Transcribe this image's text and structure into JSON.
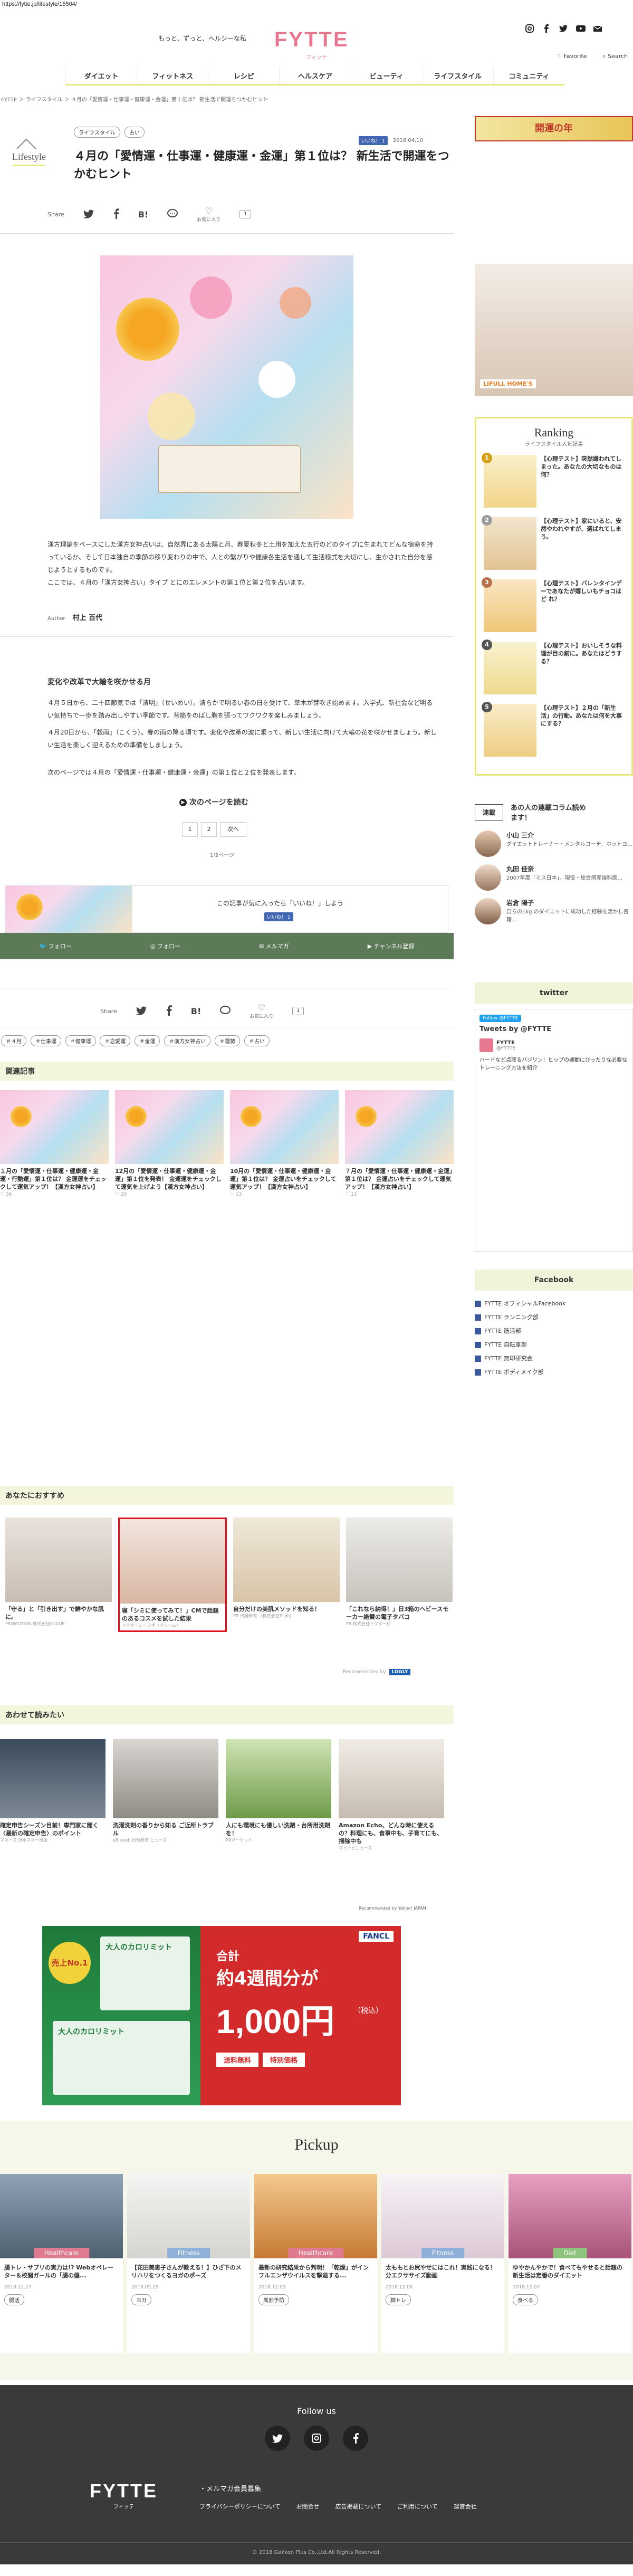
{
  "url": "https://fytte.jp/lifestyle/15504/",
  "header": {
    "tagline": "もっと、ずっと、ヘルシーな私",
    "logo": "FYTTE",
    "logo_sub": "フィッテ",
    "favorite": "Favorite",
    "search": "Search"
  },
  "nav": [
    "ダイエット",
    "フィットネス",
    "レシピ",
    "ヘルスケア",
    "ビューティ",
    "ライフスタイル",
    "コミュニティ"
  ],
  "breadcrumb": "FYTTE  ＞ ライフスタイル ＞ ４月の「愛情運・仕事運・健康運・金運」第１位は？ 新生活で開運をつかむヒント",
  "article": {
    "category_label": "Lifestyle",
    "tags_top": [
      "ライフスタイル",
      "占い"
    ],
    "like_label": "いいね！",
    "like_count": "1",
    "date": "2018.04.10",
    "title": "４月の「愛情運・仕事運・健康運・金運」第１位は？ 新生活で開運をつかむヒント",
    "share_label": "Share",
    "fav_label": "お気に入り",
    "intro": "漢方理論をベースにした漢方女神占いは、自然界にある太陽と月、春夏秋冬と土用を加えた五行のどのタイプに生まれてどんな宿命を持っているか、そして日本独自の季節の移り変わりの中で、人との繋がりや健康各生活を通して生活様式を大切にし、生かされた自分を感じようとするものです。",
    "intro2": "ここでは、４月の「漢方女神占い」タイプ とにのエレメントの第１位と第２位を占います。",
    "author_label": "Author",
    "author": "村上 百代",
    "subhead": "変化や改革で大輪を咲かせる月",
    "body1": "４月５日から、二十四節気では「清明」（せいめい）。清らかで明るい春の日を受けて、草木が芽吹き始めます。入学式、新社会など明るい気持ちで一歩を踏み出しやすい季節です。背筋をのばし胸を張ってワクワクを楽しみましょう。",
    "body2": "４月20日から、「穀雨」（こくう）。春の雨の降る頃です。変化や改革の波に乗って、新しい生活に向けて大輪の花を咲かせましょう。新しい生活を楽しく迎えるための準備をしましょう。",
    "body3": "次のページでは４月の「愛情運・仕事運・健康運・金運」の第１位と２位を発表します。",
    "next_page": "次のページを読む",
    "pages": [
      "1",
      "2",
      "次へ"
    ],
    "page_info": "1/2ページ",
    "like_banner": "この記事が気に入ったら「いいね！」しよう",
    "follow_items": [
      "フォロー",
      "フォロー",
      "メルマガ",
      "チャンネル登録"
    ],
    "tags_bottom": [
      "４月",
      "仕事運",
      "健康運",
      "恋愛運",
      "金運",
      "漢方女神占い",
      "運勢",
      "占い"
    ]
  },
  "related": {
    "title": "関連記事",
    "items": [
      {
        "title": "１月の「愛情運・仕事運・健康運・金運・行動運」第１位は？ 金運運をチェックして運気アップ！【漢方女神占い】",
        "likes": "36"
      },
      {
        "title": "12月の「愛情運・仕事運・健康運・金運」第１位を発表！ 金運運をチェックして運気を上げよう【漢方女神占い】",
        "likes": "20"
      },
      {
        "title": "10月の「愛情運・仕事運・健康運・金運」第１位は？ 金運占いをチェックして運気アップ！【漢方女神占い】",
        "likes": "13"
      },
      {
        "title": "７月の「愛情運・仕事運・健康運・金運」第１位は？ 金運占いをチェックして運気アップ！【漢方女神占い】",
        "likes": "13"
      }
    ]
  },
  "recommend": {
    "title": "あなたにおすすめ",
    "items": [
      {
        "title": "「守る」と「引き出す」で鮮やかな肌に。",
        "src": "PROMOTION 株式会社VOGUE"
      },
      {
        "title": "寝「シミに使ってみて！」CMで話題のあるコスメを試した結果",
        "src": "ドクターシーラボ（クリーム）"
      },
      {
        "title": "自分だけの美肌メソッドを知る！",
        "src": "PR 日経新聞 （株式会社Tsiph）"
      },
      {
        "title": "「これなら納得！」日3箱のヘビースモーカー絶賛の電子タバコ",
        "src": "PR 株式会社ドクタービ"
      }
    ],
    "powered": "Recommended by",
    "powered_brand": "LOGLY"
  },
  "awase": {
    "title": "あわせて読みたい",
    "items": [
      {
        "title": "確定申告シーズン目前！専門家に聞く〈最新の確定申告〉のポイント",
        "src": "マネーズ 日本マネー出版"
      },
      {
        "title": "洗濯洗剤の香りから知る ご近所トラブル",
        "src": "eBizweb 日刊経済 ニュース"
      },
      {
        "title": "人にも環境にも優しい洗剤・台所用洗剤を！",
        "src": "PRマーケット"
      },
      {
        "title": "Amazon Echo、どんな時に使えるの？料理にも、食事中も、子育てにも、掃除中も",
        "src": "マイナビニュース"
      }
    ],
    "powered": "Recommended by Yahoo! JAPAN"
  },
  "ad": {
    "left_title": "大人のカロリミット",
    "badge": "売上No.1",
    "brand": "FANCL",
    "total": "合計",
    "weeks": "約4週間分が",
    "price": "1,000円",
    "tax": "（税込）",
    "shipping": "送料無料",
    "special": "特別価格"
  },
  "pickup": {
    "title": "Pickup",
    "items": [
      {
        "category": "Healthcare",
        "title": "腸トレ・サプリの実力は!? Webオペレーター＆校閲ガールの「腸の健...",
        "date": "2018.12.27",
        "tag": "腸活"
      },
      {
        "category": "Fitness",
        "title": "【花田美恵子さんが教える！】ひざ下のメリハリをつくるヨガのポーズ",
        "date": "2018.05.29",
        "tag": "ヨガ"
      },
      {
        "category": "Healthcare",
        "title": "最新の研究結果から判明！「乾燥」がインフルエンザウイルスを撃退する...",
        "date": "2018.12.03",
        "tag": "風邪予防"
      },
      {
        "category": "Fitness",
        "title": "太ももとお尻やせにはこれ！実践になる！分エクササイズ動画",
        "date": "2018.12.06",
        "tag": "脚トレ"
      },
      {
        "category": "Diet",
        "title": "ゆやかんやかで！食べてもやせると話題の新生活は定番のダイエット",
        "date": "2018.12.07",
        "tag": "食べる"
      }
    ]
  },
  "footer": {
    "follow_us": "Follow us",
    "logo": "FYTTE",
    "logo_sub": "フィッテ",
    "mail": "・メルマガ会員募集",
    "links": [
      "プライバシーポリシーについて",
      "お問合せ",
      "広告掲載について",
      "ご利用について",
      "運営会社"
    ],
    "copyright": "© 2018 Gakken Plus Co.,Ltd.All Rights Reserved."
  },
  "sidebar": {
    "banner_text": "開運の年",
    "ad_brand": "LIFULL HOME'S",
    "ranking_title": "Ranking",
    "ranking_sub": "ライフスタイル人気記事",
    "ranking": [
      {
        "num": "1",
        "title": "【心理テスト】突然嫌われてしまった。あなたの大切なものは何？"
      },
      {
        "num": "2",
        "title": "【心理テスト】家にいると、安然やわれやすが、選ばれてしまう。"
      },
      {
        "num": "3",
        "title": "【心理テスト】バレンタインデーであなたが嬉しいもチョコはど れ？"
      },
      {
        "num": "4",
        "title": "【心理テスト】おいしそうな料理が目の前に。あなたはどうする？"
      },
      {
        "num": "5",
        "title": "【心理テスト】２月の「新生活」の行動。あなたは何を大事にする？"
      }
    ],
    "serial_label": "連載",
    "serial_title": "あの人の連載コラム読めます！",
    "writers": [
      {
        "name": "小山 三介",
        "desc": "ダイエットトレーナー・メンタルコーチ、ホットヨ..."
      },
      {
        "name": "丸田 佳奈",
        "desc": "2007年度「ミス日本」。現役・総合病産婦科医..."
      },
      {
        "name": "岩倉 陽子",
        "desc": "自らの1kg のダイエットに成功した経験を活かし書籍..."
      }
    ],
    "twitter_title": "twitter",
    "twitter_follow": "Follow @FYTTE",
    "tweets_by": "Tweets by @FYTTE",
    "tweet_name": "FYTTE",
    "tweet_handle": "@FYTTE",
    "tweet_text": "ハードなど点取るバジリン！ヒップの運動にぴったりな必要なトレーニング方法を紹介",
    "facebook_title": "Facebook",
    "facebook_links": [
      "FYTTE オフィシャルFacebook",
      "FYTTE ランニング部",
      "FYTTE 筋活部",
      "FYTTE 自転車部",
      "FYTTE 無印研究会",
      "FYTTE ボディメイク部"
    ]
  }
}
